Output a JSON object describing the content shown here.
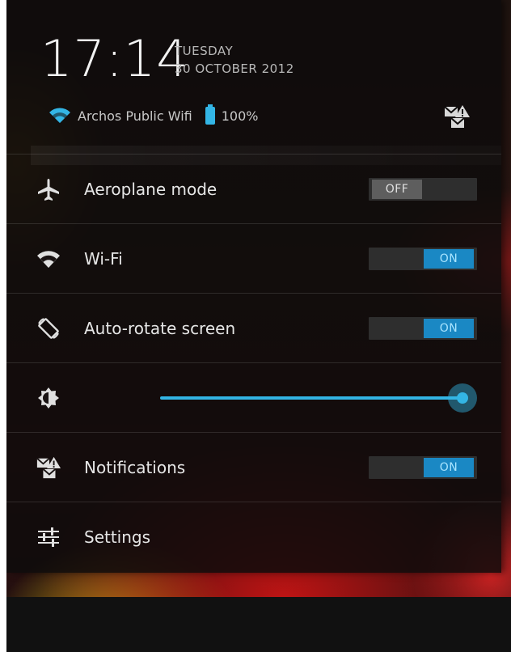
{
  "header": {
    "time": "17:14",
    "day": "TUESDAY",
    "date": "30 OCTOBER 2012",
    "network": "Archos Public Wifi",
    "battery": "100%"
  },
  "toggles": {
    "aeroplane": {
      "label": "Aeroplane mode",
      "state": "OFF"
    },
    "wifi": {
      "label": "Wi-Fi",
      "state": "ON"
    },
    "autorotate": {
      "label": "Auto-rotate screen",
      "state": "ON"
    },
    "notifications": {
      "label": "Notifications",
      "state": "ON"
    }
  },
  "brightness": {
    "level": 1.0
  },
  "settings": {
    "label": "Settings"
  },
  "colors": {
    "accent": "#33b5e5",
    "toggle_on": "#1a88c4",
    "toggle_off": "#5e5e5e",
    "panel": "#0e0c0c"
  },
  "icons": {
    "airplane": "airplane-icon",
    "wifi": "wifi-icon",
    "rotate": "auto-rotate-icon",
    "brightness": "brightness-icon",
    "notifications": "notifications-icon",
    "settings": "settings-sliders-icon",
    "battery": "battery-icon"
  }
}
